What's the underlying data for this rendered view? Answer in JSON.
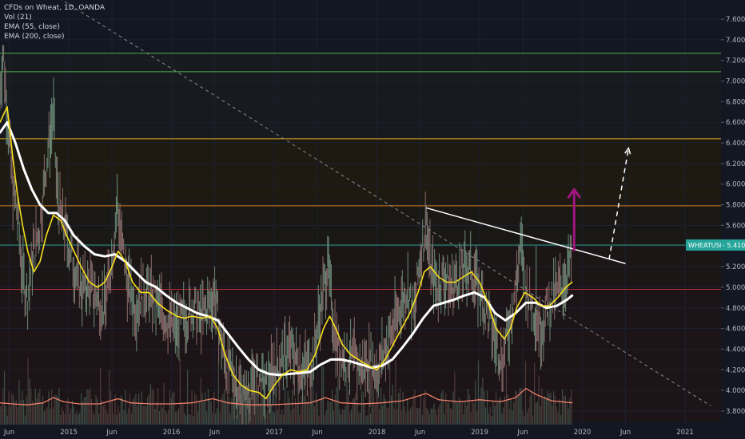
{
  "legend": {
    "title": "CFDs on Wheat, 1D, OANDA",
    "vol": "Vol (21)",
    "ema1": "EMA (55, close)",
    "ema2": "EMA (200, close)"
  },
  "colors": {
    "background": "#131722",
    "grid": "#1c2030",
    "price_up": "#6b8a78",
    "price_down": "#8a6b6b",
    "ema55": "#f7e01c",
    "ema200": "#ffffff",
    "volume_ma": "#f0806a",
    "trend_dashed": "#8a8a8a",
    "target_arrow": "#a0167e",
    "h_green": "#4caf50",
    "h_yellow": "#d8a820",
    "h_orange": "#d07a10",
    "h_teal": "#2a9a8a",
    "h_red": "#b03030",
    "price_badge": "#26a69a"
  },
  "chart_data": {
    "type": "line",
    "title": "CFDs on Wheat, 1D, OANDA",
    "ylim": [
      3.7,
      7.8
    ],
    "y_ticks": [
      "7.600",
      "7.400",
      "7.200",
      "7.000",
      "6.800",
      "6.600",
      "6.400",
      "6.200",
      "6.000",
      "5.800",
      "5.600",
      "5.400",
      "5.200",
      "5.000",
      "4.800",
      "4.600",
      "4.400",
      "4.200",
      "4.000",
      "3.800"
    ],
    "y_tick_values": [
      7.6,
      7.4,
      7.2,
      7.0,
      6.8,
      6.6,
      6.4,
      6.2,
      6.0,
      5.8,
      5.6,
      5.4,
      5.2,
      5.0,
      4.8,
      4.6,
      4.4,
      4.2,
      4.0,
      3.8
    ],
    "x_ticks": [
      {
        "label": "Jun",
        "t": 2014.42
      },
      {
        "label": "2015",
        "t": 2015.0
      },
      {
        "label": "Jun",
        "t": 2015.42
      },
      {
        "label": "2016",
        "t": 2016.0
      },
      {
        "label": "Jun",
        "t": 2016.42
      },
      {
        "label": "2017",
        "t": 2017.0
      },
      {
        "label": "Jun",
        "t": 2017.42
      },
      {
        "label": "2018",
        "t": 2018.0
      },
      {
        "label": "Jun",
        "t": 2018.42
      },
      {
        "label": "2019",
        "t": 2019.0
      },
      {
        "label": "Jun",
        "t": 2019.42
      },
      {
        "label": "2020",
        "t": 2020.0
      },
      {
        "label": "Jun",
        "t": 2020.42
      },
      {
        "label": "2021",
        "t": 2021.0
      }
    ],
    "xlim": [
      2014.33,
      2021.35
    ],
    "price_label": {
      "name": "WHEATUSD",
      "value": "5.410",
      "y": 5.41
    },
    "horizontal_levels": [
      {
        "y": 7.27,
        "color_key": "h_green"
      },
      {
        "y": 7.09,
        "color_key": "h_green"
      },
      {
        "y": 6.44,
        "color_key": "h_yellow"
      },
      {
        "y": 5.79,
        "color_key": "h_orange"
      },
      {
        "y": 5.41,
        "color_key": "h_teal"
      },
      {
        "y": 4.98,
        "color_key": "h_red"
      }
    ],
    "price_path": [
      [
        2014.33,
        6.9
      ],
      [
        2014.36,
        7.3
      ],
      [
        2014.4,
        6.7
      ],
      [
        2014.45,
        6.0
      ],
      [
        2014.5,
        5.7
      ],
      [
        2014.55,
        5.1
      ],
      [
        2014.6,
        4.9
      ],
      [
        2014.65,
        5.3
      ],
      [
        2014.72,
        5.6
      ],
      [
        2014.78,
        6.2
      ],
      [
        2014.85,
        6.7
      ],
      [
        2014.88,
        6.0
      ],
      [
        2014.92,
        5.7
      ],
      [
        2014.98,
        5.5
      ],
      [
        2015.05,
        5.2
      ],
      [
        2015.12,
        5.0
      ],
      [
        2015.2,
        5.0
      ],
      [
        2015.28,
        4.9
      ],
      [
        2015.35,
        4.8
      ],
      [
        2015.42,
        5.3
      ],
      [
        2015.47,
        5.8
      ],
      [
        2015.52,
        5.4
      ],
      [
        2015.58,
        5.0
      ],
      [
        2015.65,
        4.8
      ],
      [
        2015.72,
        5.0
      ],
      [
        2015.8,
        4.9
      ],
      [
        2015.88,
        4.8
      ],
      [
        2015.95,
        4.7
      ],
      [
        2016.05,
        4.6
      ],
      [
        2016.12,
        4.7
      ],
      [
        2016.2,
        4.8
      ],
      [
        2016.28,
        4.7
      ],
      [
        2016.35,
        4.8
      ],
      [
        2016.42,
        4.9
      ],
      [
        2016.48,
        4.5
      ],
      [
        2016.55,
        4.2
      ],
      [
        2016.62,
        4.1
      ],
      [
        2016.7,
        3.9
      ],
      [
        2016.78,
        4.0
      ],
      [
        2016.85,
        4.1
      ],
      [
        2016.92,
        4.0
      ],
      [
        2017.0,
        4.2
      ],
      [
        2017.08,
        4.3
      ],
      [
        2017.15,
        4.4
      ],
      [
        2017.22,
        4.3
      ],
      [
        2017.3,
        4.2
      ],
      [
        2017.38,
        4.3
      ],
      [
        2017.45,
        4.8
      ],
      [
        2017.52,
        5.2
      ],
      [
        2017.56,
        4.8
      ],
      [
        2017.62,
        4.4
      ],
      [
        2017.7,
        4.3
      ],
      [
        2017.78,
        4.3
      ],
      [
        2017.85,
        4.2
      ],
      [
        2017.92,
        4.3
      ],
      [
        2018.0,
        4.2
      ],
      [
        2018.08,
        4.4
      ],
      [
        2018.15,
        4.6
      ],
      [
        2018.22,
        4.8
      ],
      [
        2018.3,
        5.0
      ],
      [
        2018.36,
        4.7
      ],
      [
        2018.42,
        5.3
      ],
      [
        2018.48,
        5.6
      ],
      [
        2018.52,
        5.2
      ],
      [
        2018.58,
        5.0
      ],
      [
        2018.65,
        5.1
      ],
      [
        2018.72,
        5.0
      ],
      [
        2018.8,
        5.1
      ],
      [
        2018.88,
        5.2
      ],
      [
        2018.95,
        5.1
      ],
      [
        2019.02,
        4.9
      ],
      [
        2019.08,
        4.7
      ],
      [
        2019.15,
        4.5
      ],
      [
        2019.22,
        4.3
      ],
      [
        2019.28,
        4.6
      ],
      [
        2019.35,
        5.0
      ],
      [
        2019.4,
        5.4
      ],
      [
        2019.45,
        5.0
      ],
      [
        2019.52,
        4.8
      ],
      [
        2019.6,
        4.6
      ],
      [
        2019.66,
        4.8
      ],
      [
        2019.72,
        4.9
      ],
      [
        2019.78,
        5.0
      ],
      [
        2019.84,
        5.1
      ],
      [
        2019.9,
        5.3
      ]
    ],
    "price_spikes": [
      [
        2014.36,
        7.35
      ],
      [
        2014.85,
        6.7
      ],
      [
        2015.47,
        6.1
      ],
      [
        2016.42,
        5.2
      ],
      [
        2017.52,
        5.5
      ],
      [
        2018.48,
        5.8
      ],
      [
        2019.4,
        5.5
      ],
      [
        2019.55,
        5.4
      ]
    ],
    "ema55": [
      [
        2014.33,
        6.6
      ],
      [
        2014.4,
        6.75
      ],
      [
        2014.45,
        6.3
      ],
      [
        2014.5,
        5.9
      ],
      [
        2014.55,
        5.6
      ],
      [
        2014.6,
        5.35
      ],
      [
        2014.66,
        5.15
      ],
      [
        2014.72,
        5.25
      ],
      [
        2014.78,
        5.5
      ],
      [
        2014.85,
        5.7
      ],
      [
        2014.92,
        5.65
      ],
      [
        2014.98,
        5.5
      ],
      [
        2015.05,
        5.35
      ],
      [
        2015.12,
        5.2
      ],
      [
        2015.2,
        5.05
      ],
      [
        2015.28,
        5.0
      ],
      [
        2015.35,
        5.05
      ],
      [
        2015.42,
        5.2
      ],
      [
        2015.48,
        5.35
      ],
      [
        2015.55,
        5.25
      ],
      [
        2015.62,
        5.05
      ],
      [
        2015.7,
        4.95
      ],
      [
        2015.78,
        4.95
      ],
      [
        2015.86,
        4.85
      ],
      [
        2015.95,
        4.78
      ],
      [
        2016.05,
        4.72
      ],
      [
        2016.12,
        4.7
      ],
      [
        2016.2,
        4.72
      ],
      [
        2016.3,
        4.7
      ],
      [
        2016.38,
        4.72
      ],
      [
        2016.45,
        4.6
      ],
      [
        2016.52,
        4.35
      ],
      [
        2016.6,
        4.15
      ],
      [
        2016.68,
        4.05
      ],
      [
        2016.76,
        4.0
      ],
      [
        2016.85,
        3.98
      ],
      [
        2016.92,
        3.92
      ],
      [
        2017.0,
        4.05
      ],
      [
        2017.08,
        4.15
      ],
      [
        2017.16,
        4.2
      ],
      [
        2017.24,
        4.18
      ],
      [
        2017.32,
        4.2
      ],
      [
        2017.4,
        4.35
      ],
      [
        2017.48,
        4.6
      ],
      [
        2017.54,
        4.72
      ],
      [
        2017.6,
        4.6
      ],
      [
        2017.66,
        4.45
      ],
      [
        2017.74,
        4.35
      ],
      [
        2017.82,
        4.3
      ],
      [
        2017.9,
        4.25
      ],
      [
        2018.0,
        4.2
      ],
      [
        2018.08,
        4.3
      ],
      [
        2018.16,
        4.45
      ],
      [
        2018.24,
        4.6
      ],
      [
        2018.32,
        4.75
      ],
      [
        2018.4,
        4.95
      ],
      [
        2018.46,
        5.15
      ],
      [
        2018.52,
        5.2
      ],
      [
        2018.6,
        5.1
      ],
      [
        2018.68,
        5.05
      ],
      [
        2018.76,
        5.05
      ],
      [
        2018.84,
        5.1
      ],
      [
        2018.92,
        5.15
      ],
      [
        2019.0,
        5.05
      ],
      [
        2019.08,
        4.85
      ],
      [
        2019.16,
        4.6
      ],
      [
        2019.24,
        4.5
      ],
      [
        2019.3,
        4.6
      ],
      [
        2019.36,
        4.8
      ],
      [
        2019.44,
        4.95
      ],
      [
        2019.52,
        4.9
      ],
      [
        2019.6,
        4.82
      ],
      [
        2019.68,
        4.82
      ],
      [
        2019.76,
        4.9
      ],
      [
        2019.84,
        5.0
      ],
      [
        2019.9,
        5.05
      ]
    ],
    "ema200": [
      [
        2014.33,
        6.5
      ],
      [
        2014.4,
        6.6
      ],
      [
        2014.48,
        6.4
      ],
      [
        2014.56,
        6.15
      ],
      [
        2014.64,
        5.95
      ],
      [
        2014.72,
        5.8
      ],
      [
        2014.8,
        5.72
      ],
      [
        2014.88,
        5.72
      ],
      [
        2014.96,
        5.65
      ],
      [
        2015.05,
        5.5
      ],
      [
        2015.15,
        5.4
      ],
      [
        2015.25,
        5.32
      ],
      [
        2015.35,
        5.3
      ],
      [
        2015.45,
        5.32
      ],
      [
        2015.55,
        5.25
      ],
      [
        2015.65,
        5.15
      ],
      [
        2015.75,
        5.05
      ],
      [
        2015.85,
        5.0
      ],
      [
        2015.95,
        4.92
      ],
      [
        2016.05,
        4.85
      ],
      [
        2016.15,
        4.8
      ],
      [
        2016.25,
        4.75
      ],
      [
        2016.35,
        4.72
      ],
      [
        2016.45,
        4.68
      ],
      [
        2016.55,
        4.55
      ],
      [
        2016.65,
        4.42
      ],
      [
        2016.75,
        4.3
      ],
      [
        2016.85,
        4.2
      ],
      [
        2016.95,
        4.16
      ],
      [
        2017.05,
        4.15
      ],
      [
        2017.15,
        4.16
      ],
      [
        2017.25,
        4.17
      ],
      [
        2017.35,
        4.18
      ],
      [
        2017.45,
        4.25
      ],
      [
        2017.55,
        4.3
      ],
      [
        2017.65,
        4.3
      ],
      [
        2017.75,
        4.28
      ],
      [
        2017.85,
        4.25
      ],
      [
        2017.95,
        4.22
      ],
      [
        2018.05,
        4.24
      ],
      [
        2018.15,
        4.3
      ],
      [
        2018.25,
        4.42
      ],
      [
        2018.35,
        4.55
      ],
      [
        2018.45,
        4.7
      ],
      [
        2018.55,
        4.82
      ],
      [
        2018.65,
        4.85
      ],
      [
        2018.75,
        4.88
      ],
      [
        2018.85,
        4.92
      ],
      [
        2018.95,
        4.95
      ],
      [
        2019.05,
        4.9
      ],
      [
        2019.15,
        4.75
      ],
      [
        2019.25,
        4.68
      ],
      [
        2019.35,
        4.75
      ],
      [
        2019.45,
        4.85
      ],
      [
        2019.55,
        4.85
      ],
      [
        2019.65,
        4.8
      ],
      [
        2019.75,
        4.82
      ],
      [
        2019.85,
        4.88
      ],
      [
        2019.9,
        4.92
      ]
    ],
    "volume_ma": [
      [
        2014.33,
        3.88
      ],
      [
        2014.45,
        3.87
      ],
      [
        2014.6,
        3.86
      ],
      [
        2014.75,
        3.88
      ],
      [
        2014.85,
        3.93
      ],
      [
        2014.95,
        3.89
      ],
      [
        2015.1,
        3.87
      ],
      [
        2015.3,
        3.87
      ],
      [
        2015.48,
        3.92
      ],
      [
        2015.6,
        3.88
      ],
      [
        2015.8,
        3.87
      ],
      [
        2016.0,
        3.87
      ],
      [
        2016.2,
        3.88
      ],
      [
        2016.4,
        3.92
      ],
      [
        2016.55,
        3.88
      ],
      [
        2016.75,
        3.86
      ],
      [
        2016.95,
        3.86
      ],
      [
        2017.15,
        3.87
      ],
      [
        2017.35,
        3.88
      ],
      [
        2017.5,
        3.93
      ],
      [
        2017.65,
        3.88
      ],
      [
        2017.85,
        3.87
      ],
      [
        2018.05,
        3.88
      ],
      [
        2018.25,
        3.9
      ],
      [
        2018.48,
        3.97
      ],
      [
        2018.6,
        3.91
      ],
      [
        2018.8,
        3.89
      ],
      [
        2019.0,
        3.91
      ],
      [
        2019.2,
        3.89
      ],
      [
        2019.35,
        3.93
      ],
      [
        2019.45,
        4.02
      ],
      [
        2019.55,
        3.96
      ],
      [
        2019.7,
        3.9
      ],
      [
        2019.9,
        3.88
      ]
    ],
    "trend_dashed": [
      [
        2014.75,
        7.9
      ],
      [
        2021.25,
        3.85
      ]
    ],
    "trend_white": [
      [
        2018.48,
        5.77
      ],
      [
        2020.42,
        5.23
      ]
    ],
    "target_arrow": [
      [
        2019.92,
        5.35
      ],
      [
        2019.92,
        5.95
      ]
    ],
    "projection_dashed": [
      [
        2020.26,
        5.27
      ],
      [
        2020.45,
        6.35
      ]
    ]
  }
}
